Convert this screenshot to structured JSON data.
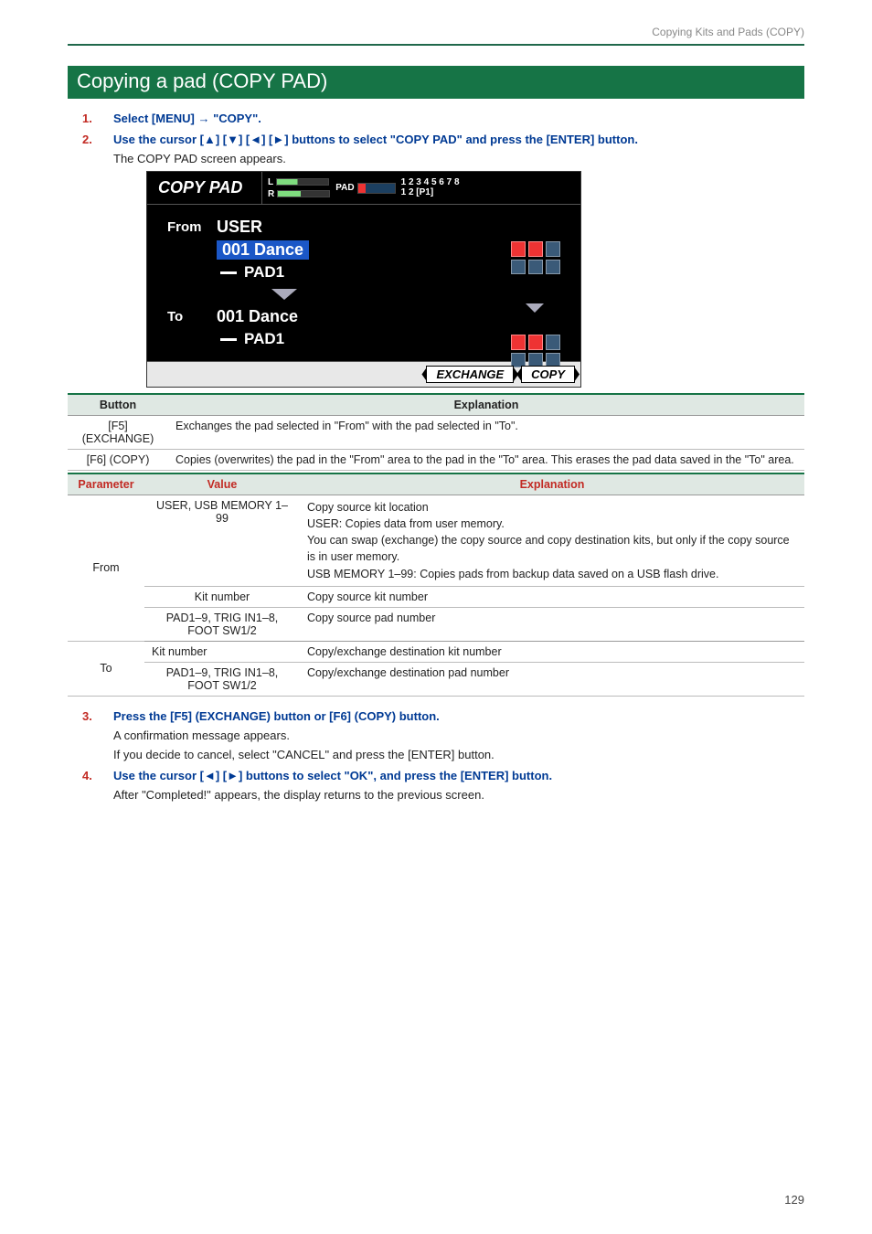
{
  "header": {
    "breadcrumb": "Copying Kits and Pads (COPY)"
  },
  "section": {
    "title": "Copying a pad (COPY PAD)"
  },
  "steps": {
    "s1": {
      "num": "1.",
      "text": "Select [MENU] → \"COPY\"."
    },
    "s2": {
      "num": "2.",
      "text": "Use the cursor [▲] [▼] [◄] [►] buttons to select \"COPY PAD\" and press the [ENTER] button.",
      "sub": "The COPY PAD screen appears."
    },
    "s3": {
      "num": "3.",
      "text": "Press the [F5] (EXCHANGE) button or [F6] (COPY) button.",
      "sub1": "A confirmation message appears.",
      "sub2": "If you decide to cancel, select \"CANCEL\" and press the [ENTER] button."
    },
    "s4": {
      "num": "4.",
      "text": "Use the cursor [◄] [►] buttons to select \"OK\", and press the [ENTER] button.",
      "sub": "After \"Completed!\" appears, the display returns to the previous screen."
    }
  },
  "screenshot": {
    "title": "COPY PAD",
    "meter_L": "L",
    "meter_R": "R",
    "pad_label": "PAD",
    "nums_top": "1 2 3 4 5 6 7 8",
    "nums_bot": "1 2 [P1]",
    "from_label": "From",
    "from_source": "USER",
    "from_kit": "001 Dance",
    "from_pad": "PAD1",
    "to_label": "To",
    "to_kit": "001 Dance",
    "to_pad": "PAD1",
    "btn_exchange": "EXCHANGE",
    "btn_copy": "COPY"
  },
  "button_table": {
    "h1": "Button",
    "h2": "Explanation",
    "r1": {
      "btn": "[F5] (EXCHANGE)",
      "exp": "Exchanges the pad selected in \"From\" with the pad selected in \"To\"."
    },
    "r2": {
      "btn": "[F6] (COPY)",
      "exp": "Copies (overwrites) the pad in the \"From\" area to the pad in the \"To\" area. This erases the pad data saved in the \"To\" area."
    }
  },
  "param_table": {
    "h1": "Parameter",
    "h2": "Value",
    "h3": "Explanation",
    "from_label": "From",
    "from_r1": {
      "val": "USER, USB MEMORY 1–99",
      "exp_l1": "Copy source kit location",
      "exp_l2": "USER: Copies data from user memory.",
      "exp_l3": "You can swap (exchange) the copy source and copy destination kits, but only if the copy source is in user memory.",
      "exp_l4": "USB MEMORY 1–99: Copies pads from backup data saved on a USB flash drive."
    },
    "from_r2": {
      "val": "Kit number",
      "exp": "Copy source kit number"
    },
    "from_r3": {
      "val": "PAD1–9, TRIG IN1–8, FOOT SW1/2",
      "exp": "Copy source pad number"
    },
    "to_label": "To",
    "to_r1": {
      "val": "Kit number",
      "exp": "Copy/exchange destination kit number"
    },
    "to_r2": {
      "val": "PAD1–9, TRIG IN1–8, FOOT SW1/2",
      "exp": "Copy/exchange destination pad number"
    }
  },
  "page_number": "129"
}
